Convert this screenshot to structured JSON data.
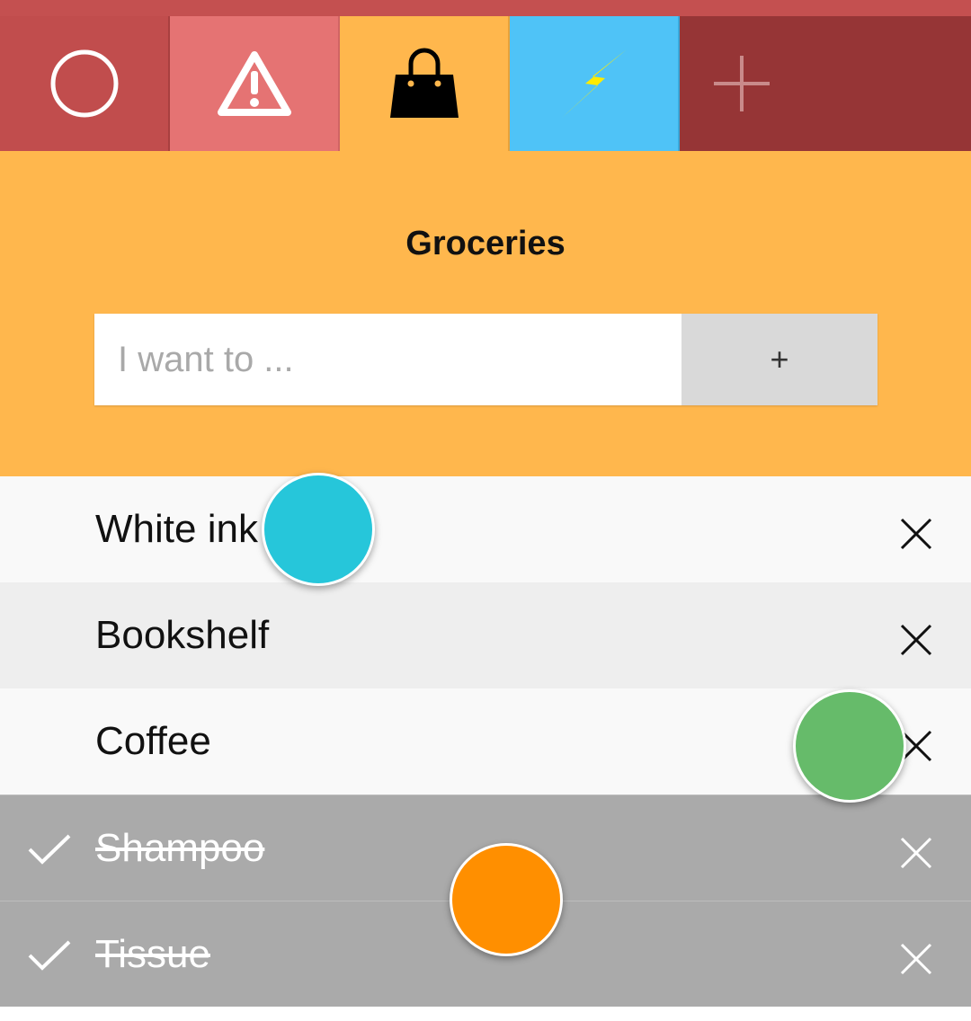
{
  "colors": {
    "accent": "#ffb74d",
    "tab_circle": "#c14d4d",
    "tab_warning": "#e57373",
    "tab_shopping": "#ffb74d",
    "tab_lightning": "#4fc3f7",
    "tab_add": "#963536",
    "done_row": "#aaaaaa"
  },
  "tabs": [
    {
      "icon": "circle-icon"
    },
    {
      "icon": "warning-icon"
    },
    {
      "icon": "shopping-bag-icon",
      "active": true
    },
    {
      "icon": "lightning-icon"
    },
    {
      "icon": "plus-icon"
    }
  ],
  "list": {
    "title": "Groceries",
    "input": {
      "placeholder": "I want to ...",
      "value": ""
    },
    "add_label": "+"
  },
  "items": [
    {
      "label": "White ink",
      "done": false
    },
    {
      "label": "Bookshelf",
      "done": false
    },
    {
      "label": "Coffee",
      "done": false
    },
    {
      "label": "Shampoo",
      "done": true
    },
    {
      "label": "Tissue",
      "done": true
    }
  ],
  "touch_indicators": [
    {
      "color": "#26c6da"
    },
    {
      "color": "#66bb6a"
    },
    {
      "color": "#ff8f00"
    }
  ]
}
